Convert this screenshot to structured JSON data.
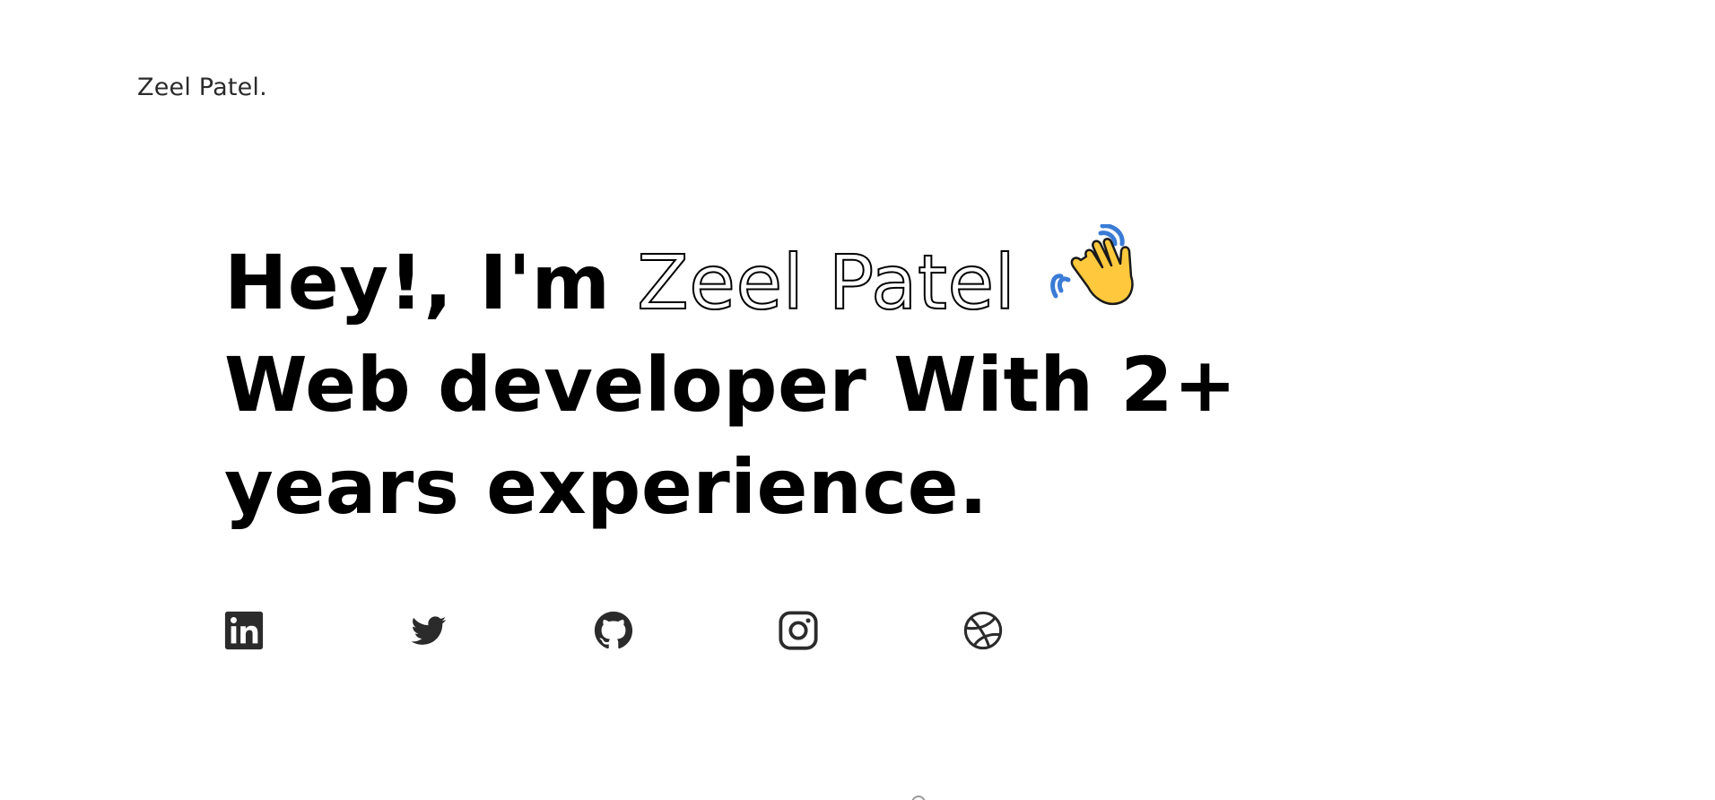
{
  "header": {
    "brand": "Zeel Patel."
  },
  "hero": {
    "greeting": "Hey!, I'm ",
    "name": "Zeel Patel",
    "line2": "Web developer With 2+",
    "line3": "years experience.",
    "emoji_icon": "waving-hand-icon"
  },
  "socials": [
    {
      "name": "linkedin",
      "icon": "linkedin-icon"
    },
    {
      "name": "twitter",
      "icon": "twitter-icon"
    },
    {
      "name": "github",
      "icon": "github-icon"
    },
    {
      "name": "instagram",
      "icon": "instagram-icon"
    },
    {
      "name": "dribbble",
      "icon": "dribbble-icon"
    }
  ],
  "colors": {
    "text": "#000000",
    "icon": "#2b2b2b",
    "background": "#ffffff",
    "wave_yellow": "#FFC83D",
    "wave_blue": "#3A7BD5"
  }
}
